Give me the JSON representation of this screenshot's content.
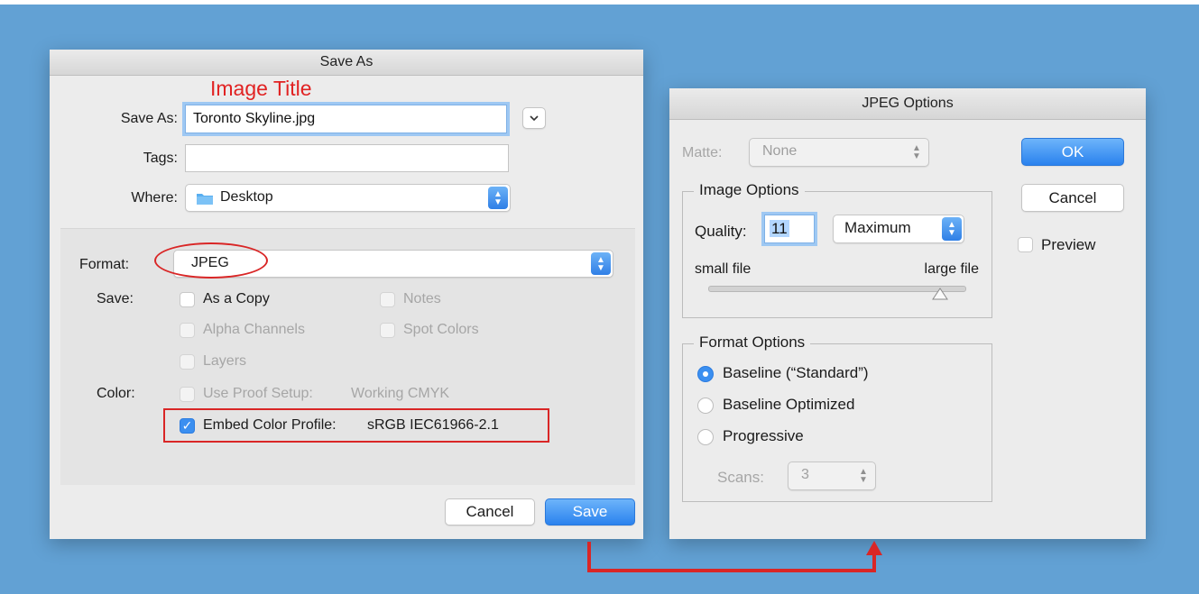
{
  "annotation": {
    "image_title": "Image Title"
  },
  "save_dialog": {
    "title": "Save As",
    "save_as_label": "Save As:",
    "filename": "Toronto Skyline.jpg",
    "tags_label": "Tags:",
    "tags_value": "",
    "where_label": "Where:",
    "where_value": "Desktop",
    "format_label": "Format:",
    "format_value": "JPEG",
    "save_label": "Save:",
    "options": {
      "as_a_copy": "As a Copy",
      "notes": "Notes",
      "alpha_channels": "Alpha Channels",
      "spot_colors": "Spot Colors",
      "layers": "Layers"
    },
    "color_label": "Color:",
    "use_proof_setup": "Use Proof Setup:",
    "working_cmyk": "Working CMYK",
    "embed_profile": "Embed Color Profile:",
    "profile_name": "sRGB IEC61966-2.1",
    "cancel_label": "Cancel",
    "save_button_label": "Save"
  },
  "jpeg_dialog": {
    "title": "JPEG Options",
    "matte_label": "Matte:",
    "matte_value": "None",
    "ok_label": "OK",
    "cancel_label": "Cancel",
    "preview_label": "Preview",
    "image_options": {
      "legend": "Image Options",
      "quality_label": "Quality:",
      "quality_value": "11",
      "quality_preset": "Maximum",
      "small_file": "small file",
      "large_file": "large file"
    },
    "format_options": {
      "legend": "Format Options",
      "baseline_standard": "Baseline (“Standard”)",
      "baseline_optimized": "Baseline Optimized",
      "progressive": "Progressive",
      "scans_label": "Scans:",
      "scans_value": "3"
    }
  }
}
